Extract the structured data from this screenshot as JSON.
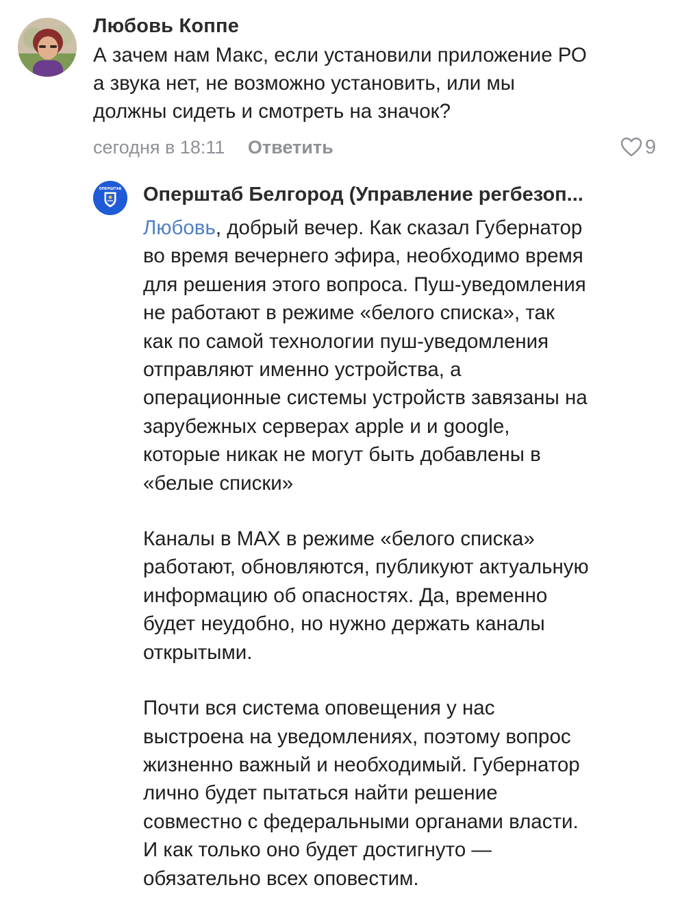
{
  "comment": {
    "author": "Любовь Коппе",
    "lines": [
      "А зачем нам Макс, если установили приложение РО",
      "а звука нет, не возможно установить, или мы",
      "должны сидеть и смотреть на значок?"
    ],
    "time": "сегодня в 18:11",
    "reply_label": "Ответить",
    "like_icon": "heart-outline-icon",
    "like_count": "9"
  },
  "reply": {
    "author": "Оперштаб Белгород (Управление регбезоп...",
    "avatar_text": "ОПЕРШТАБ",
    "mention": "Любовь",
    "paragraph1_lines": [
      ", добрый вечер. Как сказал Губернатор",
      "во время вечернего эфира, необходимо время",
      "для решения этого вопроса. Пуш-уведомления",
      "не работают в режиме «белого списка», так",
      "как по самой технологии пуш-уведомления",
      "отправляют именно устройства, а",
      "операционные системы устройств завязаны на",
      "зарубежных серверах apple и и google,",
      "которые никак не могут быть добавлены в",
      "«белые списки»"
    ],
    "paragraph2_lines": [
      "Каналы в МАХ в режиме «белого списка»",
      "работают, обновляются, публикуют актуальную",
      "информацию об опасностях. Да, временно",
      "будет неудобно, но нужно держать каналы",
      "открытыми."
    ],
    "paragraph3_lines": [
      "Почти вся система оповещения у нас",
      "выстроена на уведомлениях, поэтому вопрос",
      "жизненно важный и необходимый. Губернатор",
      "лично будет пытаться найти решение",
      "совместно с федеральными органами власти.",
      "И как только оно будет достигнуто —",
      "обязательно всех оповестим."
    ]
  },
  "colors": {
    "text": "#1f1f21",
    "meta": "#8e9196",
    "mention": "#4f7fc5",
    "reply_avatar": "#1f5bd6"
  }
}
